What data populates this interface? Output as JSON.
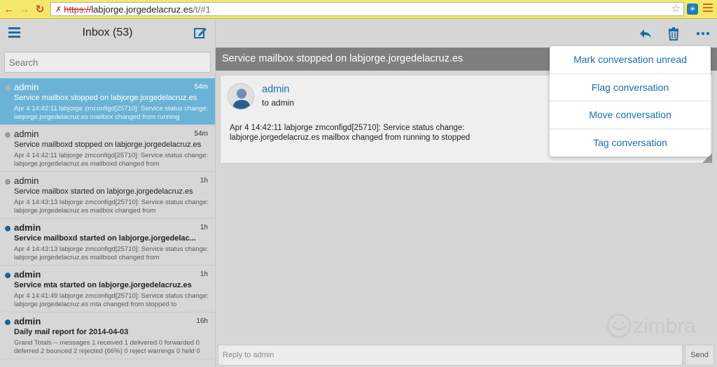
{
  "browser": {
    "url_scheme": "https://",
    "url_host": "labjorge.jorgedelacruz.es",
    "url_path": "/t/#1"
  },
  "sidebar": {
    "title": "Inbox (53)",
    "search_placeholder": "Search"
  },
  "messages": [
    {
      "sender": "admin",
      "time": "54m",
      "subject": "Service mailbox stopped on labjorge.jorgedelacruz.es",
      "preview": "Apr 4 14:42:11 labjorge zmconfigd[25710]: Service status change: labjorge.jorgedelacruz.es mailbox changed from running",
      "unread": false,
      "selected": true
    },
    {
      "sender": "admin",
      "time": "54m",
      "subject": "Service mailboxd stopped on labjorge.jorgedelacruz.es",
      "preview": "Apr 4 14:42:11 labjorge zmconfigd[25710]: Service status change: labjorge.jorgedelacruz.es mailboxd changed from",
      "unread": false,
      "selected": false
    },
    {
      "sender": "admin",
      "time": "1h",
      "subject": "Service mailbox started on labjorge.jorgedelacruz.es",
      "preview": "Apr 4 14:43:13 labjorge zmconfigd[25710]: Service status change: labjorge.jorgedelacruz.es mailbox changed from",
      "unread": false,
      "selected": false
    },
    {
      "sender": "admin",
      "time": "1h",
      "subject": "Service mailboxd started on labjorge.jorgedelac...",
      "preview": "Apr 4 14:43:13 labjorge zmconfigd[25710]: Service status change: labjorge.jorgedelacruz.es mailboxd changed from",
      "unread": true,
      "selected": false
    },
    {
      "sender": "admin",
      "time": "1h",
      "subject": "Service mta started on labjorge.jorgedelacruz.es",
      "preview": "Apr 4 14:41:49 labjorge zmconfigd[25710]: Service status change: labjorge.jorgedelacruz.es mta changed from stopped to",
      "unread": true,
      "selected": false
    },
    {
      "sender": "admin",
      "time": "16h",
      "subject": "Daily mail report for 2014-04-03",
      "preview": "Grand Totals -- messages 1 received 1 delivered 0 forwarded 0 deferred 2 bounced 2 rejected (66%) 0 reject warnings 0 held 0",
      "unread": true,
      "selected": false
    }
  ],
  "conversation": {
    "title": "Service mailbox stopped on labjorge.jorgedelacruz.es",
    "sender": "admin",
    "to": "to admin",
    "body": "Apr  4 14:42:11 labjorge zmconfigd[25710]: Service status change: labjorge.jorgedelacruz.es mailbox changed from running to stopped"
  },
  "menu": {
    "items": [
      "Mark conversation unread",
      "Flag conversation",
      "Move conversation",
      "Tag conversation"
    ]
  },
  "reply": {
    "placeholder": "Reply to admin",
    "send_label": "Send"
  },
  "brand": {
    "logo_text": "zimbra"
  },
  "colors": {
    "accent": "#1c6ea4",
    "selected_row": "#6bb3d6",
    "header_bar": "#7f7f7f",
    "browser_bar": "#f3e86b"
  }
}
